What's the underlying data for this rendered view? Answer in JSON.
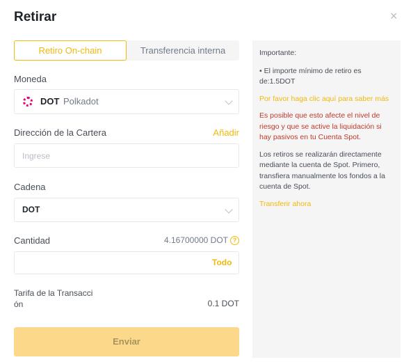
{
  "header": {
    "title": "Retirar",
    "close_glyph": "×"
  },
  "tabs": [
    {
      "label": "Retiro On-chain",
      "active": true
    },
    {
      "label": "Transferencia interna",
      "active": false
    }
  ],
  "coin": {
    "label": "Moneda",
    "symbol": "DOT",
    "name": "Polkadot",
    "icon": "polkadot-icon"
  },
  "address": {
    "label": "Dirección de la Cartera",
    "add_link": "Añadir",
    "placeholder": "Ingrese",
    "value": ""
  },
  "network": {
    "label": "Cadena",
    "value": "DOT"
  },
  "amount": {
    "label": "Cantidad",
    "available": "4.16700000 DOT",
    "help_glyph": "?",
    "placeholder": "",
    "max_label": "Todo"
  },
  "fee": {
    "label": "Tarifa de la Transacción",
    "value": "0.1 DOT"
  },
  "submit_label": "Enviar",
  "info_panel": {
    "heading": "Importante:",
    "min_note": "• El importe mínimo de retiro es de:1.5DOT",
    "more_link": "Por favor haga clic aquí para saber más",
    "risk_warning": "Es posible que esto afecte el nivel de riesgo y que se active la liquidación si hay pasivos en tu Cuenta Spot.",
    "spot_note": "Los retiros se realizarán directamente mediante la cuenta de Spot. Primero, transfiera manualmente los fondos a la cuenta de Spot.",
    "transfer_link": "Transferir ahora"
  },
  "colors": {
    "accent": "#f0b90b",
    "warning": "#c0392b",
    "submit_disabled": "#fcd98a",
    "panel_bg": "#f5f5f5",
    "polkadot": "#e6007a"
  }
}
